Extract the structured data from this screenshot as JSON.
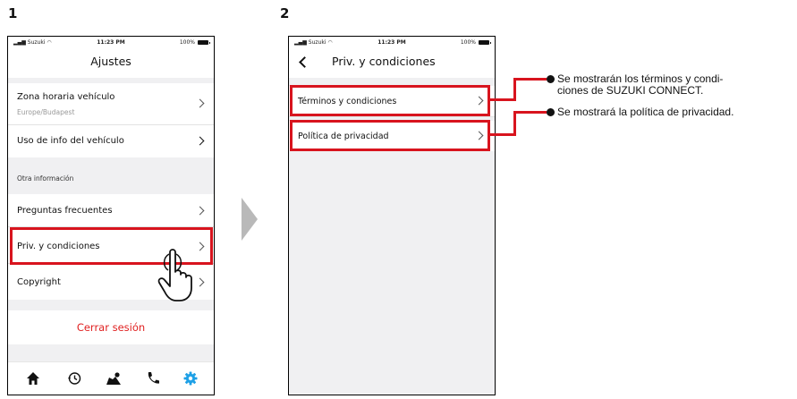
{
  "steps": [
    "1",
    "2"
  ],
  "status_bar": {
    "carrier": "Suzuki",
    "time": "11:23 PM",
    "battery": "100%"
  },
  "screen1": {
    "title": "Ajustes",
    "rows": {
      "timezone": {
        "label": "Zona horaria vehículo",
        "sub": "Europe/Budapest"
      },
      "vehicle_info": {
        "label": "Uso de info del vehículo"
      },
      "section": "Otra información",
      "faq": {
        "label": "Preguntas frecuentes"
      },
      "privacy": {
        "label": "Priv. y condiciones"
      },
      "copyright": {
        "label": "Copyright"
      }
    },
    "logout": "Cerrar sesión",
    "tabs": [
      "home-icon",
      "history-icon",
      "map-icon",
      "phone-icon",
      "gear-icon"
    ],
    "accent_color": "#1ea0e6",
    "logout_color": "#e02020"
  },
  "screen2": {
    "title": "Priv. y condiciones",
    "rows": {
      "terms": {
        "label": "Términos y condiciones"
      },
      "policy": {
        "label": "Política de privacidad"
      }
    }
  },
  "callouts": {
    "terms": [
      "Se mostrarán los términos y condi-",
      "ciones de SUZUKI CONNECT."
    ],
    "policy": "Se mostrará la política de privacidad."
  },
  "highlight_color": "#d8141e"
}
